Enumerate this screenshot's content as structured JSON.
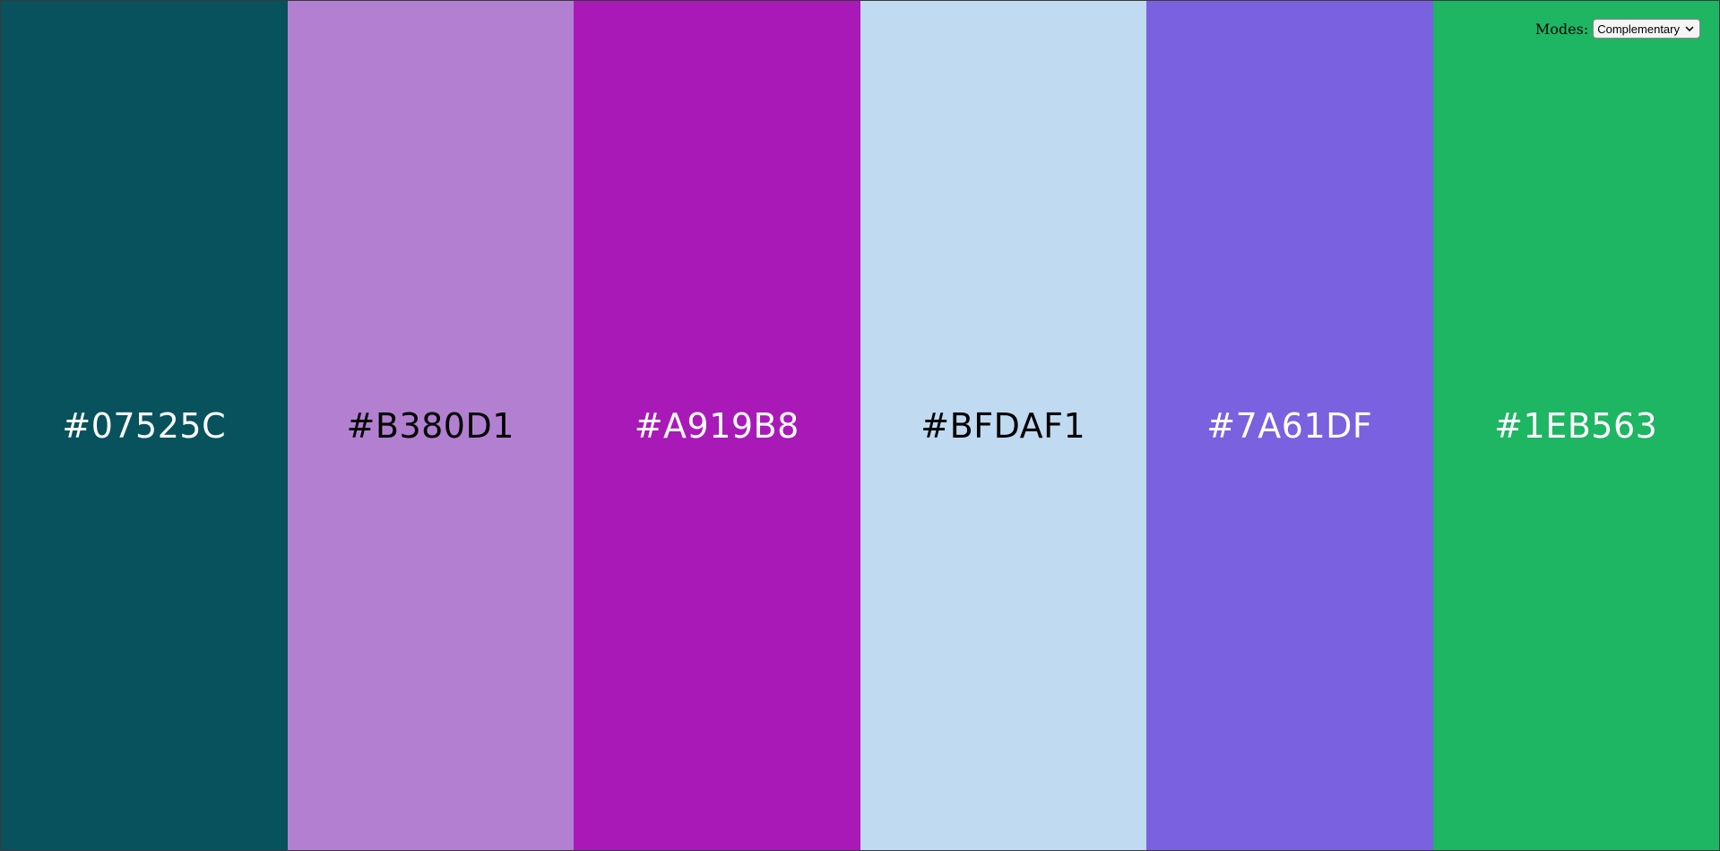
{
  "palette": [
    {
      "hex": "#07525C",
      "bg": "#07525C",
      "fg": "#FFFFFF"
    },
    {
      "hex": "#B380D1",
      "bg": "#B380D1",
      "fg": "#000000"
    },
    {
      "hex": "#A919B8",
      "bg": "#A919B8",
      "fg": "#FFFFFF"
    },
    {
      "hex": "#BFDAF1",
      "bg": "#BFDAF1",
      "fg": "#000000"
    },
    {
      "hex": "#7A61DF",
      "bg": "#7A61DF",
      "fg": "#FFFFFF"
    },
    {
      "hex": "#1EB563",
      "bg": "#1EB563",
      "fg": "#FFFFFF"
    }
  ],
  "modes": {
    "label": "Modes:",
    "selected": "Complementary",
    "icon": "chevron-down-icon"
  }
}
